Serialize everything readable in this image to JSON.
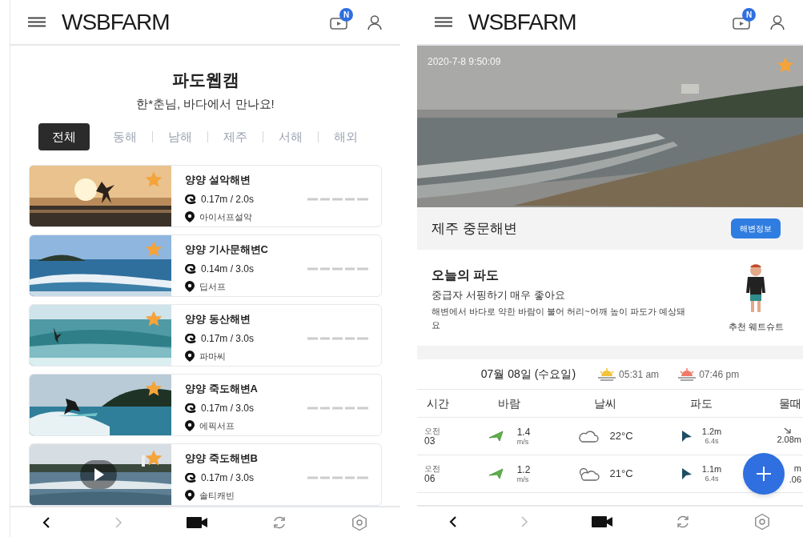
{
  "list_screen": {
    "header": {
      "logo": "**WSB**FARM",
      "badge": "N"
    },
    "title": "파도웹캠",
    "greeting": "한*춘님, 바다에서 만나요!",
    "regions": [
      {
        "label": "전체",
        "selected": true
      },
      {
        "label": "동해",
        "selected": false
      },
      {
        "label": "남해",
        "selected": false
      },
      {
        "label": "제주",
        "selected": false
      },
      {
        "label": "서해",
        "selected": false
      },
      {
        "label": "해외",
        "selected": false
      }
    ],
    "spots": [
      {
        "name": "양양 설악해변",
        "wave": "0.17m / 2.0s",
        "shop": "아이서프설악",
        "favorite": true,
        "video": false
      },
      {
        "name": "양양 기사문해변C",
        "wave": "0.14m / 3.0s",
        "shop": "딥서프",
        "favorite": true,
        "video": false
      },
      {
        "name": "양양 동산해변",
        "wave": "0.17m / 3.0s",
        "shop": "파마씨",
        "favorite": true,
        "video": false
      },
      {
        "name": "양양 죽도해변A",
        "wave": "0.17m / 3.0s",
        "shop": "에픽서프",
        "favorite": true,
        "video": false
      },
      {
        "name": "양양 죽도해변B",
        "wave": "0.17m / 3.0s",
        "shop": "솔티캐빈",
        "favorite": true,
        "video": true
      }
    ],
    "nav": {
      "back_disabled": false,
      "forward_disabled": true
    }
  },
  "detail_screen": {
    "header": {
      "logo": "**WSB**FARM",
      "badge": "N"
    },
    "webcam": {
      "timestamp": "2020-7-8 9:50:09",
      "favorite": true
    },
    "beach_name": "제주 중문해변",
    "info_button": "해변정보",
    "today": {
      "title": "오늘의 파도",
      "headline": "중급자 서핑하기 매우 좋아요",
      "description": "해변에서 바다로 약한 바람이 불어 허리~어깨 높이 파도가 예상돼요",
      "wetsuit_label": "추천 웨트슈트"
    },
    "date": "07월 08일 (수요일)",
    "sunrise": "05:31 am",
    "sunset": "07:46 pm",
    "columns": [
      "시간",
      "바람",
      "날씨",
      "파도",
      "물때"
    ],
    "rows": [
      {
        "ampm": "오전",
        "hour": "03",
        "wind": "1.4",
        "wind_unit": "m/s",
        "kind": "cloud",
        "temp": "22°C",
        "wave_height": "1.2m",
        "wave_period": "6.4s",
        "tide_arrow": true,
        "tide": [
          "2.08m"
        ]
      },
      {
        "ampm": "오전",
        "hour": "06",
        "wind": "1.2",
        "wind_unit": "m/s",
        "kind": "cloud-sun",
        "temp": "21°C",
        "wave_height": "1.1m",
        "wave_period": "6.4s",
        "tide_arrow": false,
        "tide": [
          "m",
          ".06"
        ]
      }
    ],
    "nav": {
      "back_disabled": false,
      "forward_disabled": true
    }
  }
}
